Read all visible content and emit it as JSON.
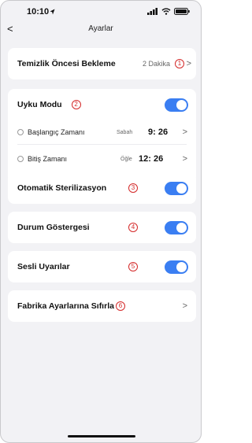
{
  "status": {
    "time": "10:10"
  },
  "nav": {
    "back": "<",
    "title": "Ayarlar"
  },
  "pre_clean": {
    "label": "Temizlik Öncesi Bekleme",
    "value": "2 Dakika",
    "badge": "1",
    "chevron": ">"
  },
  "sleep": {
    "label": "Uyku Modu",
    "badge": "2",
    "enabled": true,
    "start": {
      "label": "Başlangıç Zamanı",
      "period": "Sabah",
      "time": "9: 26",
      "chevron": ">"
    },
    "end": {
      "label": "Bitiş Zamanı",
      "period": "Öğle",
      "time": "12: 26",
      "chevron": ">"
    }
  },
  "auto_sterilization": {
    "label": "Otomatik Sterilizasyon",
    "badge": "3",
    "enabled": true
  },
  "status_indicator": {
    "label": "Durum Göstergesi",
    "badge": "4",
    "enabled": true
  },
  "sound_alerts": {
    "label": "Sesli Uyarılar",
    "badge": "5",
    "enabled": true
  },
  "factory_reset": {
    "label": "Fabrika Ayarlarına Sıfırla",
    "badge": "6",
    "chevron": ">"
  },
  "colors": {
    "accent": "#3a7ef2",
    "badge": "#d42a2a",
    "background": "#f2f2f5"
  }
}
